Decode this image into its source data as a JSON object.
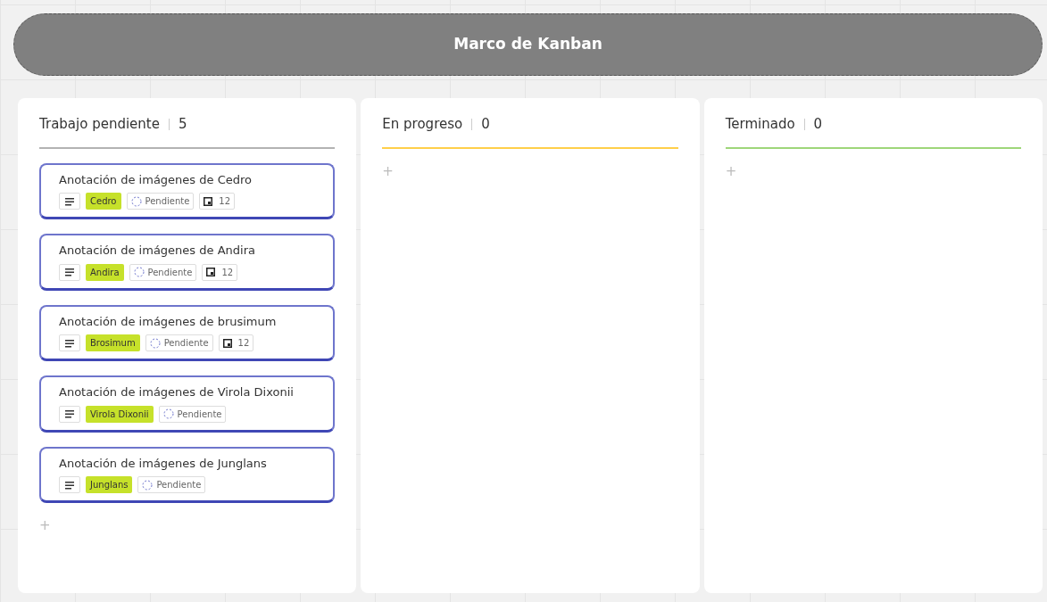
{
  "title": "Marco de Kanban",
  "columns": [
    {
      "name": "Trabajo pendiente",
      "count": "5",
      "color": "#b3b3b3",
      "add": "+",
      "cards": [
        {
          "title": "Anotación de imágenes de Cedro",
          "tag": "Cedro",
          "status": "Pendiente",
          "count": "12"
        },
        {
          "title": "Anotación de imágenes de Andira",
          "tag": "Andira",
          "status": "Pendiente",
          "count": "12"
        },
        {
          "title": "Anotación de imágenes de brusimum",
          "tag": "Brosimum",
          "status": "Pendiente",
          "count": "12"
        },
        {
          "title": "Anotación de imágenes de Virola Dixonii",
          "tag": "Virola Dixonii",
          "status": "Pendiente"
        },
        {
          "title": "Anotación de imágenes de Junglans",
          "tag": "Junglans",
          "status": "Pendiente"
        }
      ]
    },
    {
      "name": "En progreso",
      "count": "0",
      "color": "#ffcf4a",
      "add": "+"
    },
    {
      "name": "Terminado",
      "count": "0",
      "color": "#9ed67a",
      "add": "+"
    }
  ]
}
